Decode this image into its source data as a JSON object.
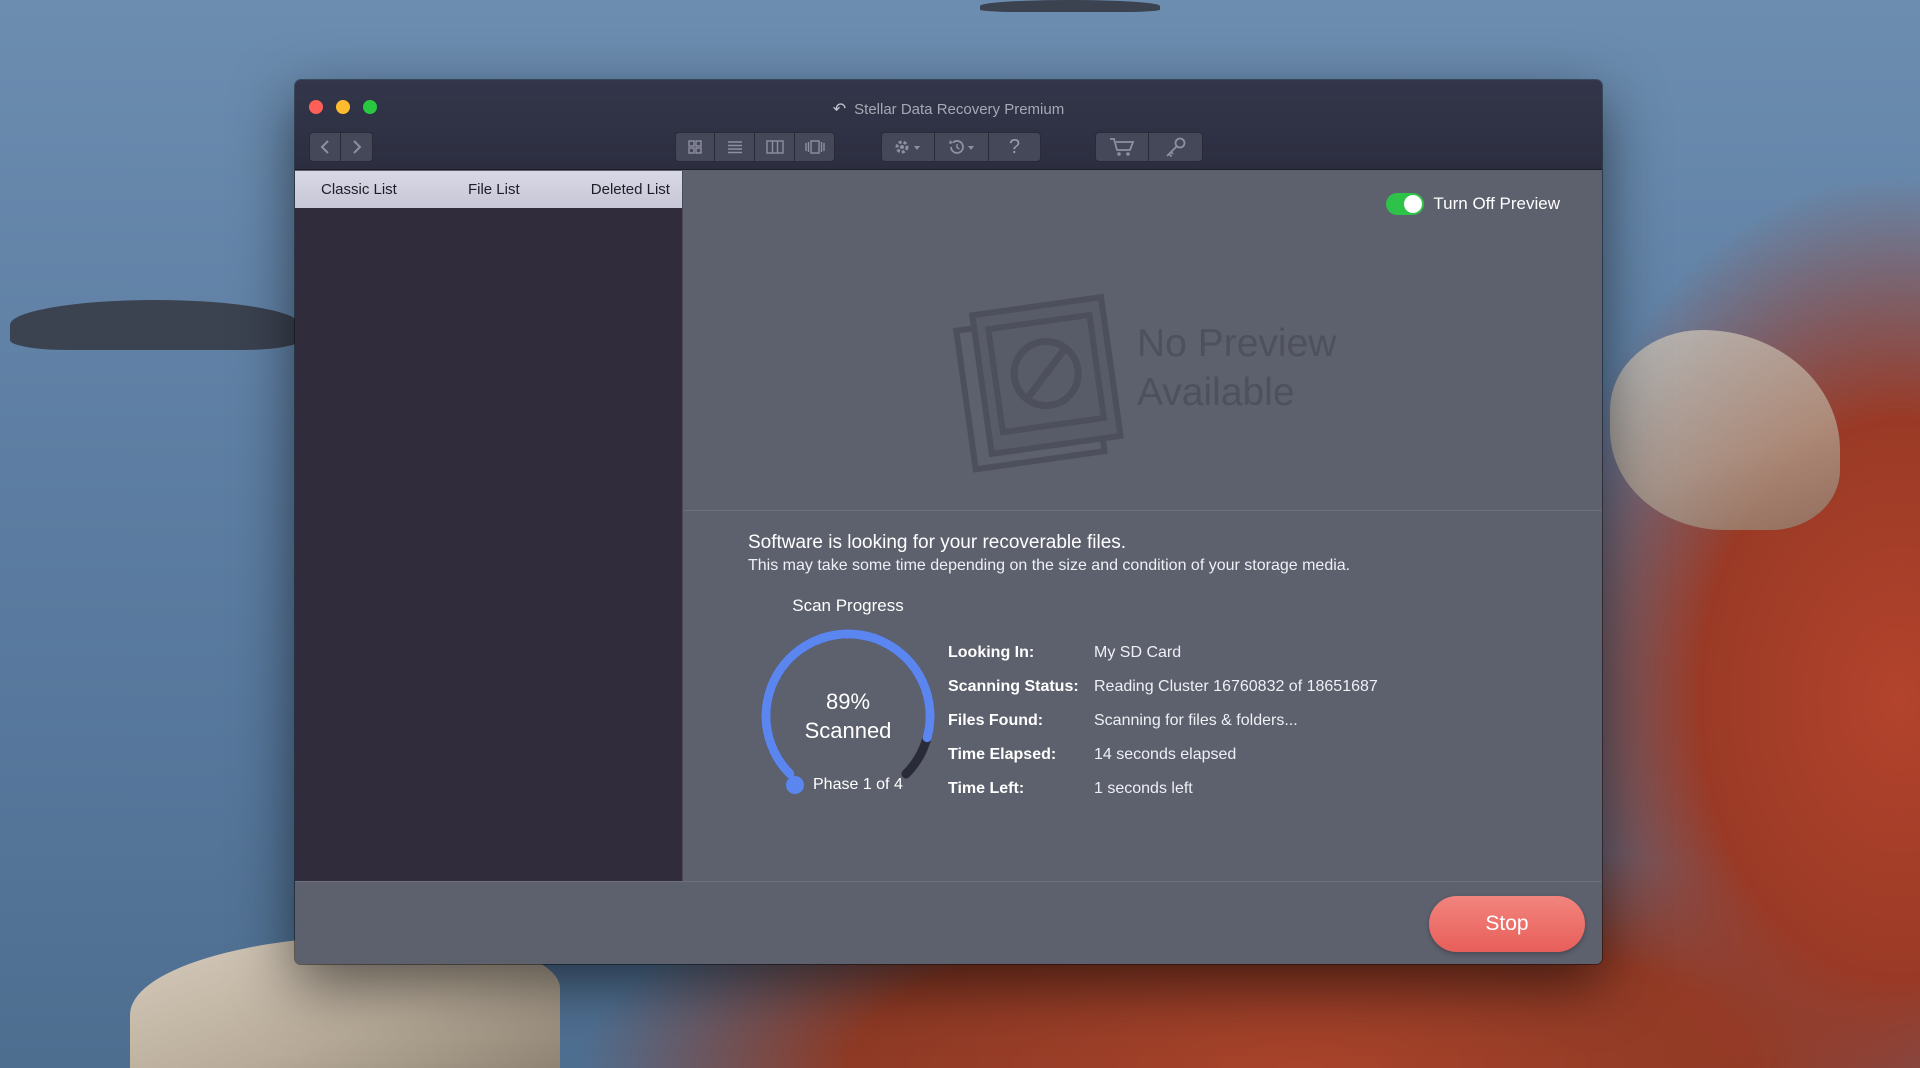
{
  "window": {
    "title": "Stellar Data Recovery Premium"
  },
  "list_tabs": [
    "Classic List",
    "File List",
    "Deleted List"
  ],
  "preview": {
    "toggle_label": "Turn Off Preview",
    "toggle_on": true,
    "no_preview_line1": "No Preview",
    "no_preview_line2": "Available"
  },
  "scan": {
    "heading": "Software is looking for your recoverable files.",
    "subheading": "This may take some time depending on the size and condition of your storage media.",
    "progress_label": "Scan Progress",
    "percent": 89,
    "percent_text": "89%",
    "scanned_label": "Scanned",
    "phase_label": "Phase 1 of 4",
    "info": [
      {
        "key": "Looking In:",
        "value": "My SD Card"
      },
      {
        "key": "Scanning Status:",
        "value": "Reading Cluster 16760832 of 18651687"
      },
      {
        "key": "Files Found:",
        "value": "Scanning for files & folders..."
      },
      {
        "key": "Time Elapsed:",
        "value": "14 seconds elapsed"
      },
      {
        "key": "Time Left:",
        "value": "1 seconds left"
      }
    ]
  },
  "footer": {
    "stop_label": "Stop"
  },
  "colors": {
    "titlebar": "#2f3144",
    "left_panel": "#312c3c",
    "content": "#5d606d",
    "toggle_on": "#2fc24b",
    "gauge_fill": "#5b86f0",
    "gauge_track": "#2a2b38",
    "stop_button": "#eb6a64"
  },
  "icons": {
    "back": "chevron-left-icon",
    "forward": "chevron-right-icon",
    "view_grid": "grid-icon",
    "view_list": "list-icon",
    "view_columns": "columns-icon",
    "view_coverflow": "coverflow-icon",
    "settings": "gear-icon",
    "history": "history-icon",
    "help": "help-icon",
    "cart": "cart-icon",
    "key": "key-icon"
  }
}
